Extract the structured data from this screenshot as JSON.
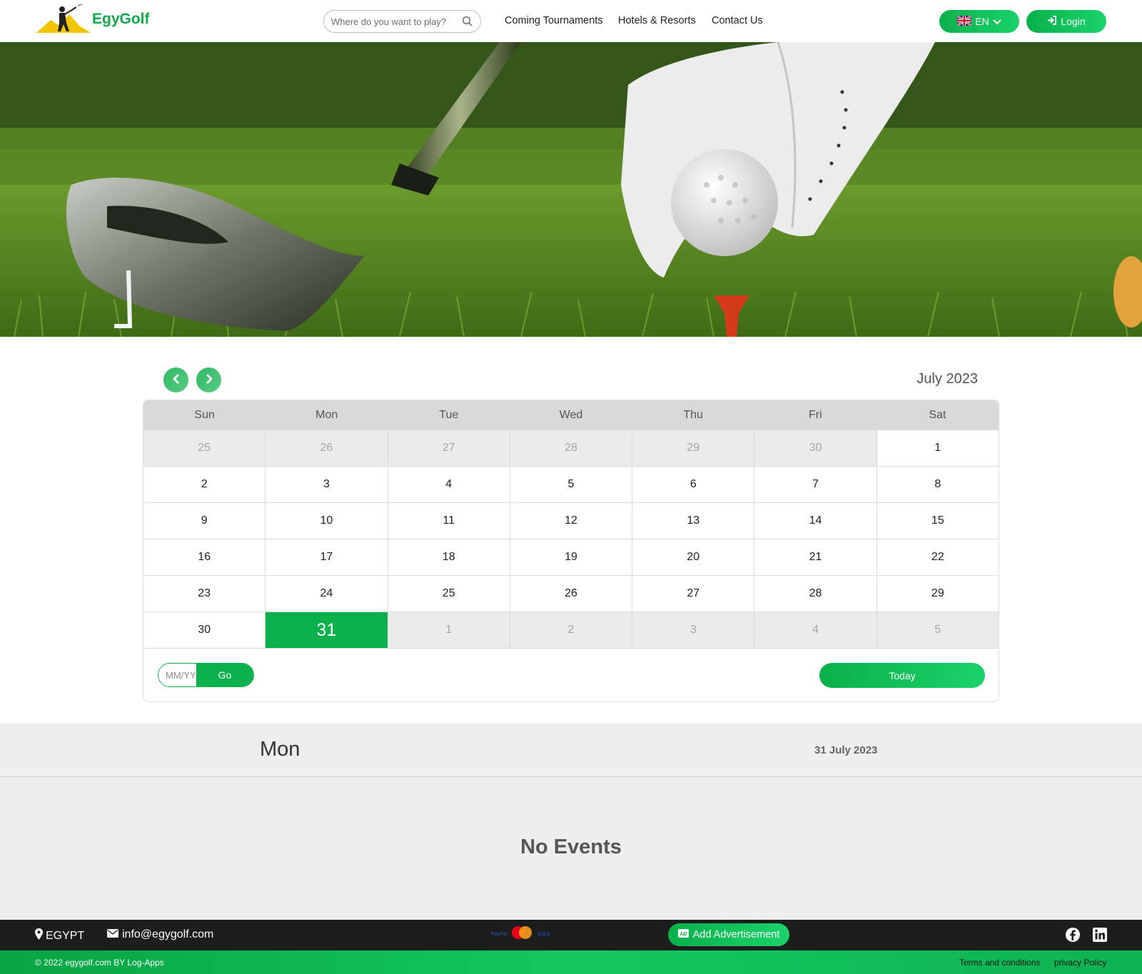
{
  "header": {
    "brand": "EgyGolf",
    "search_placeholder": "Where do you want to play?",
    "nav": [
      "Coming Tournaments",
      "Hotels & Resorts",
      "Contact Us"
    ],
    "lang_label": "EN",
    "login_label": "Login"
  },
  "calendar": {
    "month_label": "July 2023",
    "weekdays": [
      "Sun",
      "Mon",
      "Tue",
      "Wed",
      "Thu",
      "Fri",
      "Sat"
    ],
    "weeks": [
      [
        {
          "d": "25",
          "other": true
        },
        {
          "d": "26",
          "other": true
        },
        {
          "d": "27",
          "other": true
        },
        {
          "d": "28",
          "other": true
        },
        {
          "d": "29",
          "other": true
        },
        {
          "d": "30",
          "other": true
        },
        {
          "d": "1"
        }
      ],
      [
        {
          "d": "2"
        },
        {
          "d": "3"
        },
        {
          "d": "4"
        },
        {
          "d": "5"
        },
        {
          "d": "6"
        },
        {
          "d": "7"
        },
        {
          "d": "8"
        }
      ],
      [
        {
          "d": "9"
        },
        {
          "d": "10"
        },
        {
          "d": "11"
        },
        {
          "d": "12"
        },
        {
          "d": "13"
        },
        {
          "d": "14"
        },
        {
          "d": "15"
        }
      ],
      [
        {
          "d": "16"
        },
        {
          "d": "17"
        },
        {
          "d": "18"
        },
        {
          "d": "19"
        },
        {
          "d": "20"
        },
        {
          "d": "21"
        },
        {
          "d": "22"
        }
      ],
      [
        {
          "d": "23"
        },
        {
          "d": "24"
        },
        {
          "d": "25"
        },
        {
          "d": "26"
        },
        {
          "d": "27"
        },
        {
          "d": "28"
        },
        {
          "d": "29"
        }
      ],
      [
        {
          "d": "30"
        },
        {
          "d": "31",
          "today": true
        },
        {
          "d": "1",
          "other": true
        },
        {
          "d": "2",
          "other": true
        },
        {
          "d": "3",
          "other": true
        },
        {
          "d": "4",
          "other": true
        },
        {
          "d": "5",
          "other": true
        }
      ]
    ],
    "date_input_placeholder": "MM/YYYY",
    "go_label": "Go",
    "today_label": "Today"
  },
  "day": {
    "name": "Mon",
    "date": "31 July 2023",
    "empty_message": "No Events"
  },
  "footer": {
    "location": "EGYPT",
    "email": "info@egygolf.com",
    "payments": {
      "paypal": "PayPal",
      "visa": "VISA"
    },
    "add_ad_label": "Add Advertisement",
    "copyright": "© 2022 egygolf.com BY Log-Apps",
    "terms": "Terms and conditions",
    "privacy": "privacy Policy"
  },
  "colors": {
    "brand_green": "#0ab14c",
    "footer_dark": "#1d1d1d",
    "muted_bg": "#eeeeee"
  },
  "icons": [
    "search-icon",
    "uk-flag-icon",
    "chevron-down-icon",
    "login-icon",
    "chevron-left-icon",
    "chevron-right-icon",
    "map-pin-icon",
    "envelope-icon",
    "mastercard-icon",
    "ad-icon",
    "facebook-icon",
    "linkedin-icon"
  ]
}
